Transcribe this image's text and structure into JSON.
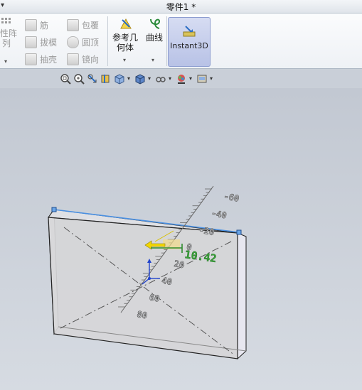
{
  "title": {
    "text": "零件1 *"
  },
  "ribbon": {
    "linear_pattern": {
      "line1": "线性阵",
      "line2": "列"
    },
    "rib": "筋",
    "wrap": "包覆",
    "draft": "拔模",
    "dome": "圆顶",
    "shell": "抽壳",
    "mirror": "镜向",
    "ref_geometry": {
      "line1": "参考几",
      "line2": "何体"
    },
    "curves": "曲线",
    "instant3d": "Instant3D"
  },
  "ruler": {
    "ticks": [
      "-60",
      "-40",
      "-20",
      "0",
      "20",
      "40",
      "60",
      "80"
    ],
    "dimension_value": "10.42"
  },
  "colors": {
    "ribbon_bg": "#eef1f5",
    "viewport_bg": "#c9cfd8",
    "dimension_green": "#2e8b2e",
    "edge_highlight": "#4a90e2",
    "instant3d_active": "#b8c2e6"
  },
  "icons": [
    "zoom-to-fit-icon",
    "zoom-area-icon",
    "previous-view-icon",
    "section-view-icon",
    "view-orientation-icon",
    "display-style-icon",
    "hide-show-icon",
    "edit-appearance-icon",
    "apply-scene-icon",
    "view-settings-icon"
  ]
}
